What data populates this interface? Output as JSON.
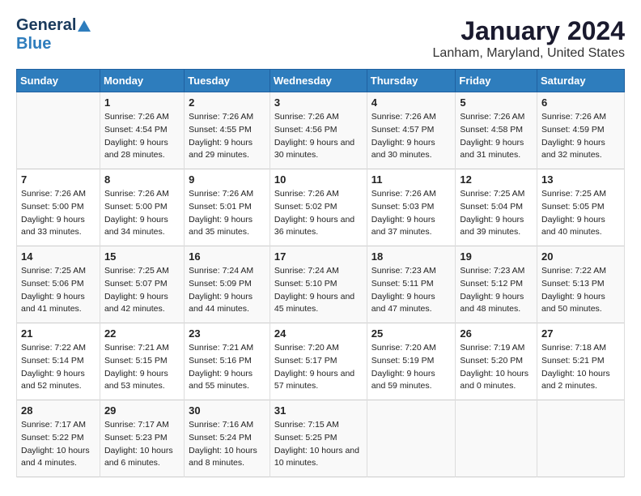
{
  "header": {
    "logo_line1": "General",
    "logo_line2": "Blue",
    "month": "January 2024",
    "location": "Lanham, Maryland, United States"
  },
  "days_of_week": [
    "Sunday",
    "Monday",
    "Tuesday",
    "Wednesday",
    "Thursday",
    "Friday",
    "Saturday"
  ],
  "weeks": [
    [
      {
        "day": "",
        "sunrise": "",
        "sunset": "",
        "daylight": ""
      },
      {
        "day": "1",
        "sunrise": "Sunrise: 7:26 AM",
        "sunset": "Sunset: 4:54 PM",
        "daylight": "Daylight: 9 hours and 28 minutes."
      },
      {
        "day": "2",
        "sunrise": "Sunrise: 7:26 AM",
        "sunset": "Sunset: 4:55 PM",
        "daylight": "Daylight: 9 hours and 29 minutes."
      },
      {
        "day": "3",
        "sunrise": "Sunrise: 7:26 AM",
        "sunset": "Sunset: 4:56 PM",
        "daylight": "Daylight: 9 hours and 30 minutes."
      },
      {
        "day": "4",
        "sunrise": "Sunrise: 7:26 AM",
        "sunset": "Sunset: 4:57 PM",
        "daylight": "Daylight: 9 hours and 30 minutes."
      },
      {
        "day": "5",
        "sunrise": "Sunrise: 7:26 AM",
        "sunset": "Sunset: 4:58 PM",
        "daylight": "Daylight: 9 hours and 31 minutes."
      },
      {
        "day": "6",
        "sunrise": "Sunrise: 7:26 AM",
        "sunset": "Sunset: 4:59 PM",
        "daylight": "Daylight: 9 hours and 32 minutes."
      }
    ],
    [
      {
        "day": "7",
        "sunrise": "Sunrise: 7:26 AM",
        "sunset": "Sunset: 5:00 PM",
        "daylight": "Daylight: 9 hours and 33 minutes."
      },
      {
        "day": "8",
        "sunrise": "Sunrise: 7:26 AM",
        "sunset": "Sunset: 5:00 PM",
        "daylight": "Daylight: 9 hours and 34 minutes."
      },
      {
        "day": "9",
        "sunrise": "Sunrise: 7:26 AM",
        "sunset": "Sunset: 5:01 PM",
        "daylight": "Daylight: 9 hours and 35 minutes."
      },
      {
        "day": "10",
        "sunrise": "Sunrise: 7:26 AM",
        "sunset": "Sunset: 5:02 PM",
        "daylight": "Daylight: 9 hours and 36 minutes."
      },
      {
        "day": "11",
        "sunrise": "Sunrise: 7:26 AM",
        "sunset": "Sunset: 5:03 PM",
        "daylight": "Daylight: 9 hours and 37 minutes."
      },
      {
        "day": "12",
        "sunrise": "Sunrise: 7:25 AM",
        "sunset": "Sunset: 5:04 PM",
        "daylight": "Daylight: 9 hours and 39 minutes."
      },
      {
        "day": "13",
        "sunrise": "Sunrise: 7:25 AM",
        "sunset": "Sunset: 5:05 PM",
        "daylight": "Daylight: 9 hours and 40 minutes."
      }
    ],
    [
      {
        "day": "14",
        "sunrise": "Sunrise: 7:25 AM",
        "sunset": "Sunset: 5:06 PM",
        "daylight": "Daylight: 9 hours and 41 minutes."
      },
      {
        "day": "15",
        "sunrise": "Sunrise: 7:25 AM",
        "sunset": "Sunset: 5:07 PM",
        "daylight": "Daylight: 9 hours and 42 minutes."
      },
      {
        "day": "16",
        "sunrise": "Sunrise: 7:24 AM",
        "sunset": "Sunset: 5:09 PM",
        "daylight": "Daylight: 9 hours and 44 minutes."
      },
      {
        "day": "17",
        "sunrise": "Sunrise: 7:24 AM",
        "sunset": "Sunset: 5:10 PM",
        "daylight": "Daylight: 9 hours and 45 minutes."
      },
      {
        "day": "18",
        "sunrise": "Sunrise: 7:23 AM",
        "sunset": "Sunset: 5:11 PM",
        "daylight": "Daylight: 9 hours and 47 minutes."
      },
      {
        "day": "19",
        "sunrise": "Sunrise: 7:23 AM",
        "sunset": "Sunset: 5:12 PM",
        "daylight": "Daylight: 9 hours and 48 minutes."
      },
      {
        "day": "20",
        "sunrise": "Sunrise: 7:22 AM",
        "sunset": "Sunset: 5:13 PM",
        "daylight": "Daylight: 9 hours and 50 minutes."
      }
    ],
    [
      {
        "day": "21",
        "sunrise": "Sunrise: 7:22 AM",
        "sunset": "Sunset: 5:14 PM",
        "daylight": "Daylight: 9 hours and 52 minutes."
      },
      {
        "day": "22",
        "sunrise": "Sunrise: 7:21 AM",
        "sunset": "Sunset: 5:15 PM",
        "daylight": "Daylight: 9 hours and 53 minutes."
      },
      {
        "day": "23",
        "sunrise": "Sunrise: 7:21 AM",
        "sunset": "Sunset: 5:16 PM",
        "daylight": "Daylight: 9 hours and 55 minutes."
      },
      {
        "day": "24",
        "sunrise": "Sunrise: 7:20 AM",
        "sunset": "Sunset: 5:17 PM",
        "daylight": "Daylight: 9 hours and 57 minutes."
      },
      {
        "day": "25",
        "sunrise": "Sunrise: 7:20 AM",
        "sunset": "Sunset: 5:19 PM",
        "daylight": "Daylight: 9 hours and 59 minutes."
      },
      {
        "day": "26",
        "sunrise": "Sunrise: 7:19 AM",
        "sunset": "Sunset: 5:20 PM",
        "daylight": "Daylight: 10 hours and 0 minutes."
      },
      {
        "day": "27",
        "sunrise": "Sunrise: 7:18 AM",
        "sunset": "Sunset: 5:21 PM",
        "daylight": "Daylight: 10 hours and 2 minutes."
      }
    ],
    [
      {
        "day": "28",
        "sunrise": "Sunrise: 7:17 AM",
        "sunset": "Sunset: 5:22 PM",
        "daylight": "Daylight: 10 hours and 4 minutes."
      },
      {
        "day": "29",
        "sunrise": "Sunrise: 7:17 AM",
        "sunset": "Sunset: 5:23 PM",
        "daylight": "Daylight: 10 hours and 6 minutes."
      },
      {
        "day": "30",
        "sunrise": "Sunrise: 7:16 AM",
        "sunset": "Sunset: 5:24 PM",
        "daylight": "Daylight: 10 hours and 8 minutes."
      },
      {
        "day": "31",
        "sunrise": "Sunrise: 7:15 AM",
        "sunset": "Sunset: 5:25 PM",
        "daylight": "Daylight: 10 hours and 10 minutes."
      },
      {
        "day": "",
        "sunrise": "",
        "sunset": "",
        "daylight": ""
      },
      {
        "day": "",
        "sunrise": "",
        "sunset": "",
        "daylight": ""
      },
      {
        "day": "",
        "sunrise": "",
        "sunset": "",
        "daylight": ""
      }
    ]
  ]
}
